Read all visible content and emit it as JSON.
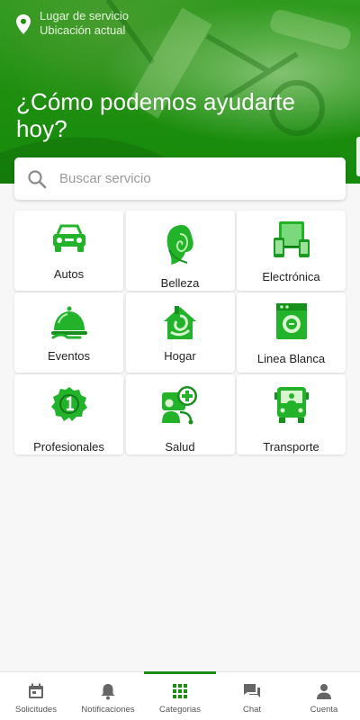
{
  "location": {
    "title": "Lugar de servicio",
    "subtitle": "Ubicación actual",
    "icon": "location-pin-icon"
  },
  "headline": "¿Cómo podemos ayudarte hoy?",
  "search": {
    "placeholder": "Buscar servicio",
    "value": ""
  },
  "categories": [
    {
      "label": "Autos",
      "icon": "car-icon"
    },
    {
      "label": "Belleza",
      "icon": "beauty-icon"
    },
    {
      "label": "Electrónica",
      "icon": "electronics-icon"
    },
    {
      "label": "Eventos",
      "icon": "catering-icon"
    },
    {
      "label": "Hogar",
      "icon": "home-icon"
    },
    {
      "label": "Linea Blanca",
      "icon": "appliance-icon"
    },
    {
      "label": "Profesionales",
      "icon": "professional-badge-icon"
    },
    {
      "label": "Salud",
      "icon": "health-icon"
    },
    {
      "label": "Transporte",
      "icon": "bus-icon"
    }
  ],
  "nav": {
    "items": [
      {
        "label": "Solicitudes",
        "icon": "calendar-icon"
      },
      {
        "label": "Notificaciones",
        "icon": "bell-icon"
      },
      {
        "label": "Categorias",
        "icon": "grid-icon",
        "active": true
      },
      {
        "label": "Chat",
        "icon": "chat-icon"
      },
      {
        "label": "Cuenta",
        "icon": "person-icon"
      }
    ]
  },
  "colors": {
    "brand_green": "#1a8c10",
    "icon_green": "#22b32a",
    "hero_dark": "#168a0b"
  }
}
